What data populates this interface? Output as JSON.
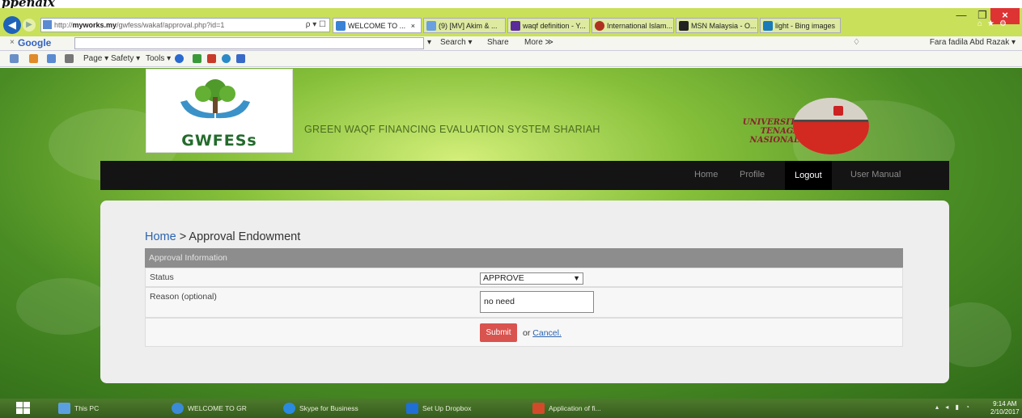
{
  "caption_fragment": "ppenaix",
  "browser": {
    "address": {
      "prefix": "http://",
      "host": "myworks.my",
      "path": "/gwfess/wakaf/approval.php?id=1",
      "actions": "ρ ▾ ☐"
    },
    "tabs": [
      {
        "label": "WELCOME TO ...",
        "close": "×"
      },
      {
        "label": "(9) [MV] Akim & ..."
      },
      {
        "label": "waqf definition - Y..."
      },
      {
        "label": "International Islam..."
      },
      {
        "label": "MSN Malaysia - O..."
      },
      {
        "label": "light - Bing images"
      }
    ],
    "google_bar": {
      "close": "×",
      "logo": "Google",
      "search": "Search ▾",
      "share": "Share",
      "more": "More ≫",
      "user": "Fara fadila Abd Razak ▾"
    },
    "command_bar": {
      "page": "Page ▾",
      "safety": "Safety ▾",
      "tools": "Tools ▾"
    }
  },
  "site": {
    "logo_text": "GWFESs",
    "system_name": "GREEN WAQF FINANCING EVALUATION SYSTEM SHARIAH",
    "university_lines": [
      "UNIVERSITI",
      "TENAGA",
      "NASIONAL"
    ],
    "nav": [
      {
        "label": "Home",
        "active": false
      },
      {
        "label": "Profile",
        "active": false
      },
      {
        "label": "Logout",
        "active": true
      },
      {
        "label": "User Manual",
        "active": false
      }
    ]
  },
  "content": {
    "breadcrumb": {
      "home": "Home",
      "sep": " > ",
      "current": "Approval Endowment"
    },
    "table_header": "Approval Information",
    "status_label": "Status",
    "status_value": "APPROVE",
    "reason_label": "Reason (optional)",
    "reason_value": "no need",
    "submit_label": "Submit",
    "or_text": " or ",
    "cancel_label": "Cancel."
  },
  "taskbar": {
    "items": [
      "This PC",
      "WELCOME TO GR...",
      "Skype for Business",
      "Set Up Dropbox",
      "Application of fi..."
    ],
    "time": "9:14 AM",
    "date": "2/10/2017"
  },
  "colors": {
    "nav_bg": "#141414",
    "submit": "#d9534f",
    "link": "#2a63b0",
    "titlebar": "#c9e05a"
  }
}
